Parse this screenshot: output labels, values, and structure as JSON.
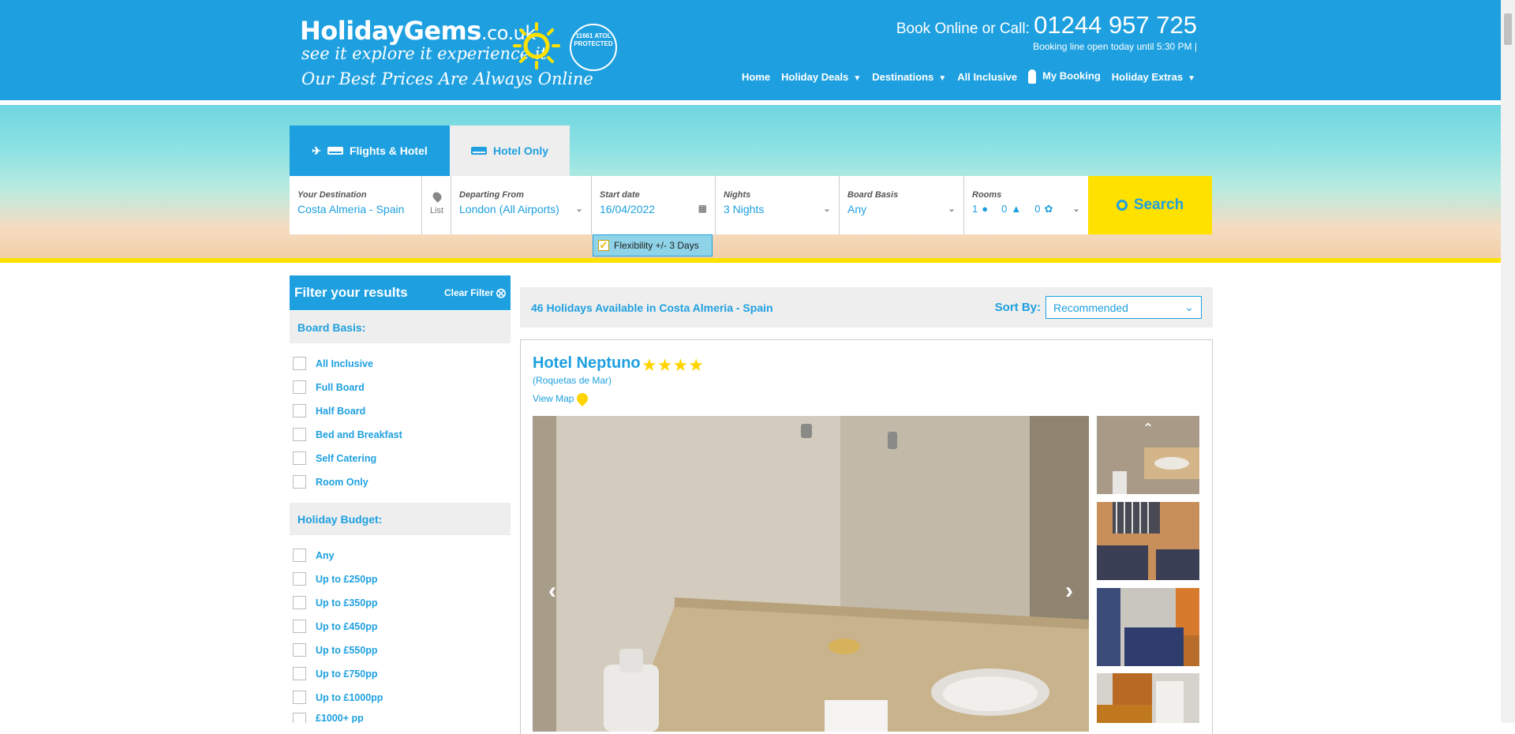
{
  "header": {
    "logo_brand": "HolidayGems",
    "logo_tld": ".co.uk",
    "logo_tagline": "see it  explore it  experience it.",
    "logo_slogan": "Our Best Prices Are Always Online",
    "atol_text": "11661 ATOL PROTECTED",
    "call_prefix": "Book Online or Call:",
    "phone": "01244 957 725",
    "booking_line": "Booking line open today until 5:30 PM |",
    "nav": [
      "Home",
      "Holiday Deals",
      "Destinations",
      "All Inclusive",
      "My Booking",
      "Holiday Extras"
    ]
  },
  "search": {
    "tabs": [
      "Flights & Hotel",
      "Hotel Only"
    ],
    "destination_label": "Your Destination",
    "destination_value": "Costa Almeria - Spain",
    "list_label": "List",
    "departing_label": "Departing From",
    "departing_value": "London (All Airports)",
    "start_label": "Start date",
    "start_value": "16/04/2022",
    "nights_label": "Nights",
    "nights_value": "3 Nights",
    "board_label": "Board Basis",
    "board_value": "Any",
    "rooms_label": "Rooms",
    "rooms_adults": "1",
    "rooms_children": "0",
    "rooms_infants": "0",
    "search_button": "Search",
    "flexibility": "Flexibility +/- 3 Days"
  },
  "filters": {
    "title": "Filter your results",
    "clear": "Clear Filter",
    "board_heading": "Board Basis:",
    "board_options": [
      "All Inclusive",
      "Full Board",
      "Half Board",
      "Bed and Breakfast",
      "Self Catering",
      "Room Only"
    ],
    "budget_heading": "Holiday Budget:",
    "budget_options": [
      "Any",
      "Up to £250pp",
      "Up to £350pp",
      "Up to £450pp",
      "Up to £550pp",
      "Up to £750pp",
      "Up to £1000pp",
      "£1000+ pp"
    ]
  },
  "results": {
    "count_text": "46 Holidays Available in Costa Almeria - Spain",
    "sort_label": "Sort By:",
    "sort_value": "Recommended",
    "hotel_name": "Hotel Neptuno",
    "hotel_stars": 4,
    "hotel_location": "(Roquetas de Mar)",
    "view_map": "View Map"
  },
  "colors": {
    "brand_blue": "#1ea0e0",
    "accent_yellow": "#ffe100"
  }
}
